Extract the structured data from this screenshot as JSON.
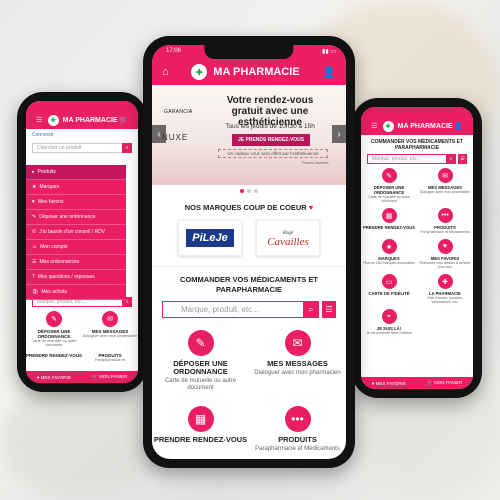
{
  "colors": {
    "accent": "#e91e63",
    "accent_dark": "#c2185b"
  },
  "center": {
    "status_time": "17:06",
    "app_title": "MA PHARMACIE",
    "banner": {
      "title": "Votre rendez-vous gratuit avec une esthéticienne",
      "subtitle": "Tous les jeudis de 10h30 à 15h",
      "button": "JE PRENDS RENDEZ-VOUS",
      "voucher": "Un cadeau vous sera offert par l'esthéticienne",
      "places": "Places limitées",
      "brand1": "GARANCIA",
      "brand2": "NUXE"
    },
    "brands_title": "NOS MARQUES COUP DE COEUR",
    "brands": [
      {
        "name": "PiLeJe"
      },
      {
        "name": "Cavailles",
        "tagline": "Rogé"
      }
    ],
    "order_title": "COMMANDER VOS MÉDICAMENTS ET PARAPHARMACIE",
    "search_placeholder": "Marque, produit, etc...",
    "tiles": [
      {
        "title": "DÉPOSER UNE ORDONNANCE",
        "sub": "Carte de mutuelle ou autre document",
        "icon": "prescription-icon"
      },
      {
        "title": "MES MESSAGES",
        "sub": "Dialoguer avec mon pharmacien",
        "icon": "chat-icon"
      },
      {
        "title": "PRENDRE RENDEZ-VOUS",
        "sub": "",
        "icon": "calendar-icon"
      },
      {
        "title": "PRODUITS",
        "sub": "Parapharmacie et Médicaments",
        "icon": "dots-icon"
      }
    ]
  },
  "left": {
    "app_title": "MA PHARMACIE",
    "header": "Connecté",
    "search_placeholder": "Chercher un produit",
    "menu": [
      "Produits",
      "Marques",
      "Mes favoris",
      "Déposer une ordonnance",
      "J'ai besoin d'un conseil / RDV",
      "Mon compte",
      "Mes ordonnances",
      "Mes questions / réponses",
      "Mes achats"
    ],
    "search2": "Marque, produit, etc...",
    "tiles": [
      {
        "title": "DÉPOSER UNE ORDONNANCE",
        "sub": "Carte de mutuelle ou autre document"
      },
      {
        "title": "MES MESSAGES",
        "sub": "Dialoguer avec mon pharmacien"
      },
      {
        "title": "PRENDRE RENDEZ-VOUS",
        "sub": ""
      },
      {
        "title": "PRODUITS",
        "sub": "Parapharmacie et"
      }
    ],
    "bottom": [
      "MES FAVORIS",
      "MON PANIER"
    ]
  },
  "right": {
    "app_title": "MA PHARMACIE",
    "order_title": "COMMANDER VOS MÉDICAMENTS ET PARAPHARMACIE",
    "search_placeholder": "Marque, produit, etc...",
    "tiles": [
      {
        "title": "DÉPOSER UNE ORDONNANCE",
        "sub": "Carte de mutuelle ou autre document"
      },
      {
        "title": "MES MESSAGES",
        "sub": "Dialoguer avec mon pharmacien"
      },
      {
        "title": "PRENDRE RENDEZ-VOUS",
        "sub": ""
      },
      {
        "title": "PRODUITS",
        "sub": "Parapharmacie et Médicaments"
      },
      {
        "title": "MARQUES",
        "sub": "Plus de 180 marques disponibles"
      },
      {
        "title": "MES FAVORIS",
        "sub": "Retrouvez mes articles à acheter plus tard"
      },
      {
        "title": "CARTE DE FIDÉLITÉ",
        "sub": ""
      },
      {
        "title": "LA PHARMACIE",
        "sub": "Plan d'accès, horaires, informations, etc."
      },
      {
        "title": "JE SUIS LÀ!",
        "sub": "Je me présente dans l'officine"
      }
    ],
    "bottom": [
      "MES FAVORIS",
      "MON PANIER"
    ]
  }
}
